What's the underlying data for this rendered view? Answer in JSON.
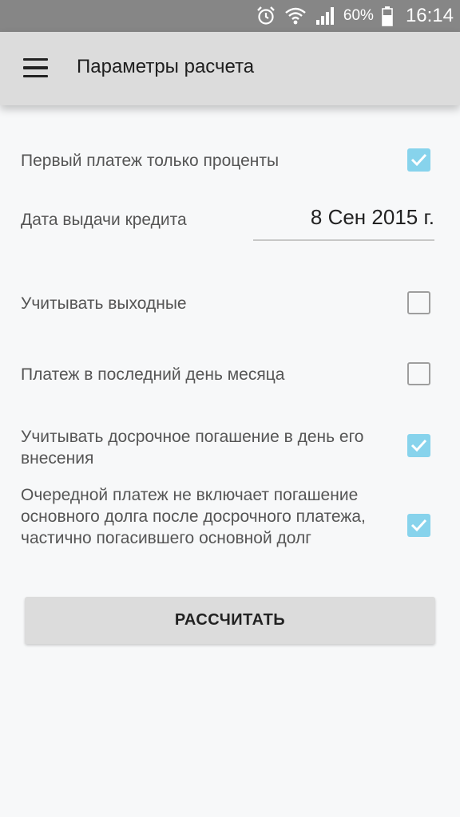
{
  "status_bar": {
    "battery_percent": "60%",
    "time": "16:14",
    "icons": [
      "alarm-icon",
      "wifi-icon",
      "signal-icon",
      "battery-icon"
    ]
  },
  "toolbar": {
    "title": "Параметры расчета",
    "menu_icon": "hamburger-menu-icon"
  },
  "settings": {
    "first_payment_interest": {
      "label": "Первый платеж только проценты",
      "checked": true
    },
    "issue_date": {
      "label": "Дата выдачи кредита",
      "value": "8 Сен 2015 г."
    },
    "count_weekends": {
      "label": "Учитывать выходные",
      "checked": false
    },
    "last_day_of_month": {
      "label": "Платеж в последний день месяца",
      "checked": false
    },
    "early_repayment_same_day": {
      "label": "Учитывать досрочное погашение в день его внесения",
      "checked": true
    },
    "next_payment_excludes_principal": {
      "label": "Очередной платеж не включает погашение основного долга после досрочного платежа, частично погасившего основной долг",
      "checked": true
    }
  },
  "actions": {
    "calculate_label": "РАССЧИТАТЬ"
  },
  "colors": {
    "checkbox_checked": "#87d3ec",
    "toolbar": "#dcdcdc",
    "status_bar": "#868686"
  }
}
